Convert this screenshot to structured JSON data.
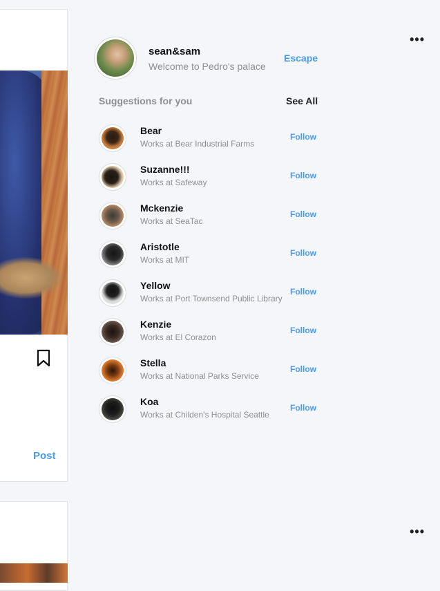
{
  "feed": {
    "post1": {
      "more_label": "•••",
      "post_label": "Post"
    },
    "post2": {
      "more_label": "•••"
    }
  },
  "profile": {
    "username": "sean&sam",
    "tagline": "Welcome to Pedro's palace",
    "escape_label": "Escape"
  },
  "suggestions": {
    "title": "Suggestions for you",
    "see_all_label": "See All",
    "items": [
      {
        "name": "Bear",
        "subtitle": "Works at Bear Industrial Farms",
        "follow_label": "Follow"
      },
      {
        "name": "Suzanne!!!",
        "subtitle": "Works at Safeway",
        "follow_label": "Follow"
      },
      {
        "name": "Mckenzie",
        "subtitle": "Works at SeaTac",
        "follow_label": "Follow"
      },
      {
        "name": "Aristotle",
        "subtitle": "Works at MIT",
        "follow_label": "Follow"
      },
      {
        "name": "Yellow",
        "subtitle": "Works at Port Townsend Public Library",
        "follow_label": "Follow"
      },
      {
        "name": "Kenzie",
        "subtitle": "Works at El Corazon",
        "follow_label": "Follow"
      },
      {
        "name": "Stella",
        "subtitle": "Works at National Parks Service",
        "follow_label": "Follow"
      },
      {
        "name": "Koa",
        "subtitle": "Works at Childen's Hospital Seattle",
        "follow_label": "Follow"
      }
    ]
  },
  "colors": {
    "accent": "#4a9be8",
    "muted": "#8e8e8e",
    "background": "#f5f6fa"
  }
}
